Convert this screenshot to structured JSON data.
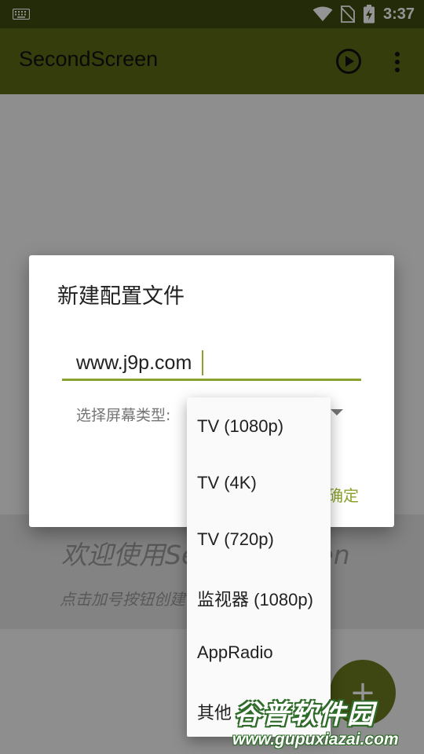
{
  "status_bar": {
    "time": "3:37",
    "icons": [
      "keyboard-icon",
      "wifi-icon",
      "no-sim-icon",
      "battery-charging-icon"
    ]
  },
  "toolbar": {
    "title": "SecondScreen",
    "actions": [
      "play-icon",
      "more-vert-icon"
    ]
  },
  "dialog": {
    "title": "新建配置文件",
    "name_value": "www.j9p.com",
    "screen_type_label": "选择屏幕类型:",
    "ok_label": "确定"
  },
  "dropdown": {
    "options": [
      "TV (1080p)",
      "TV (4K)",
      "TV (720p)",
      "监视器 (1080p)",
      "AppRadio",
      "其他"
    ]
  },
  "empty_state": {
    "title": "欢迎使用SecondScreen",
    "subtitle": "点击加号按钮创建一个配置文件"
  },
  "fab": {
    "label": "+"
  },
  "watermark": {
    "text": "谷普软件园",
    "url": "www.gupuxiazai.com"
  },
  "colors": {
    "toolbar": "#5d6a17",
    "status_bar": "#3e4a10",
    "accent": "#8aa12d",
    "fab": "#6b7a1e"
  }
}
